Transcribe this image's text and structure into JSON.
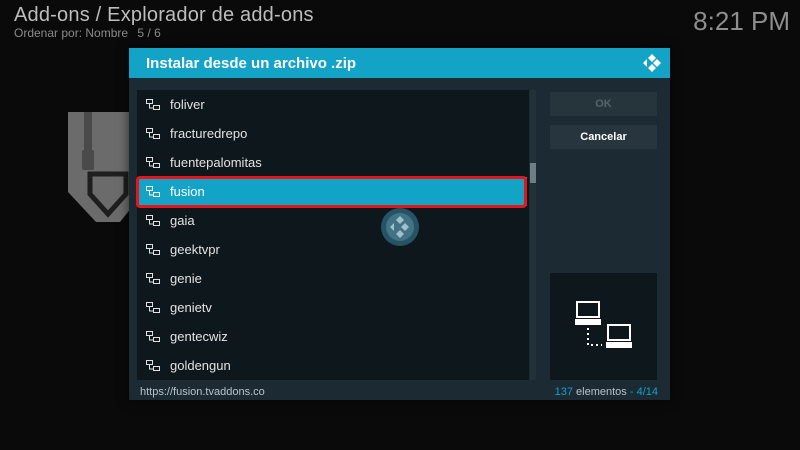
{
  "header": {
    "title": "Add-ons / Explorador de add-ons",
    "sort_label": "Ordenar por: Nombre",
    "position": "5 / 6",
    "clock": "8:21 PM"
  },
  "dialog": {
    "title": "Instalar desde un archivo .zip",
    "items": [
      {
        "label": "foliver"
      },
      {
        "label": "fracturedrepo"
      },
      {
        "label": "fuentepalomitas"
      },
      {
        "label": "fusion",
        "selected": true
      },
      {
        "label": "gaia"
      },
      {
        "label": "geektvpr"
      },
      {
        "label": "genie"
      },
      {
        "label": "genietv"
      },
      {
        "label": "gentecwiz"
      },
      {
        "label": "goldengun"
      }
    ],
    "ok_label": "OK",
    "cancel_label": "Cancelar",
    "footer_path": "https://fusion.tvaddons.co",
    "count_number": "137",
    "count_label": "elementos",
    "count_separator": "-",
    "count_page": "4/14"
  },
  "icons": {
    "item_icon": "network-share-icon",
    "preview_icon": "network-computers-icon",
    "brand_logo": "kodi-logo-icon",
    "background_icon": "zip-file-icon"
  },
  "colors": {
    "accent": "#12a3c7",
    "highlight_outline": "#e8141a",
    "dialog_bg": "#1b2a33"
  }
}
